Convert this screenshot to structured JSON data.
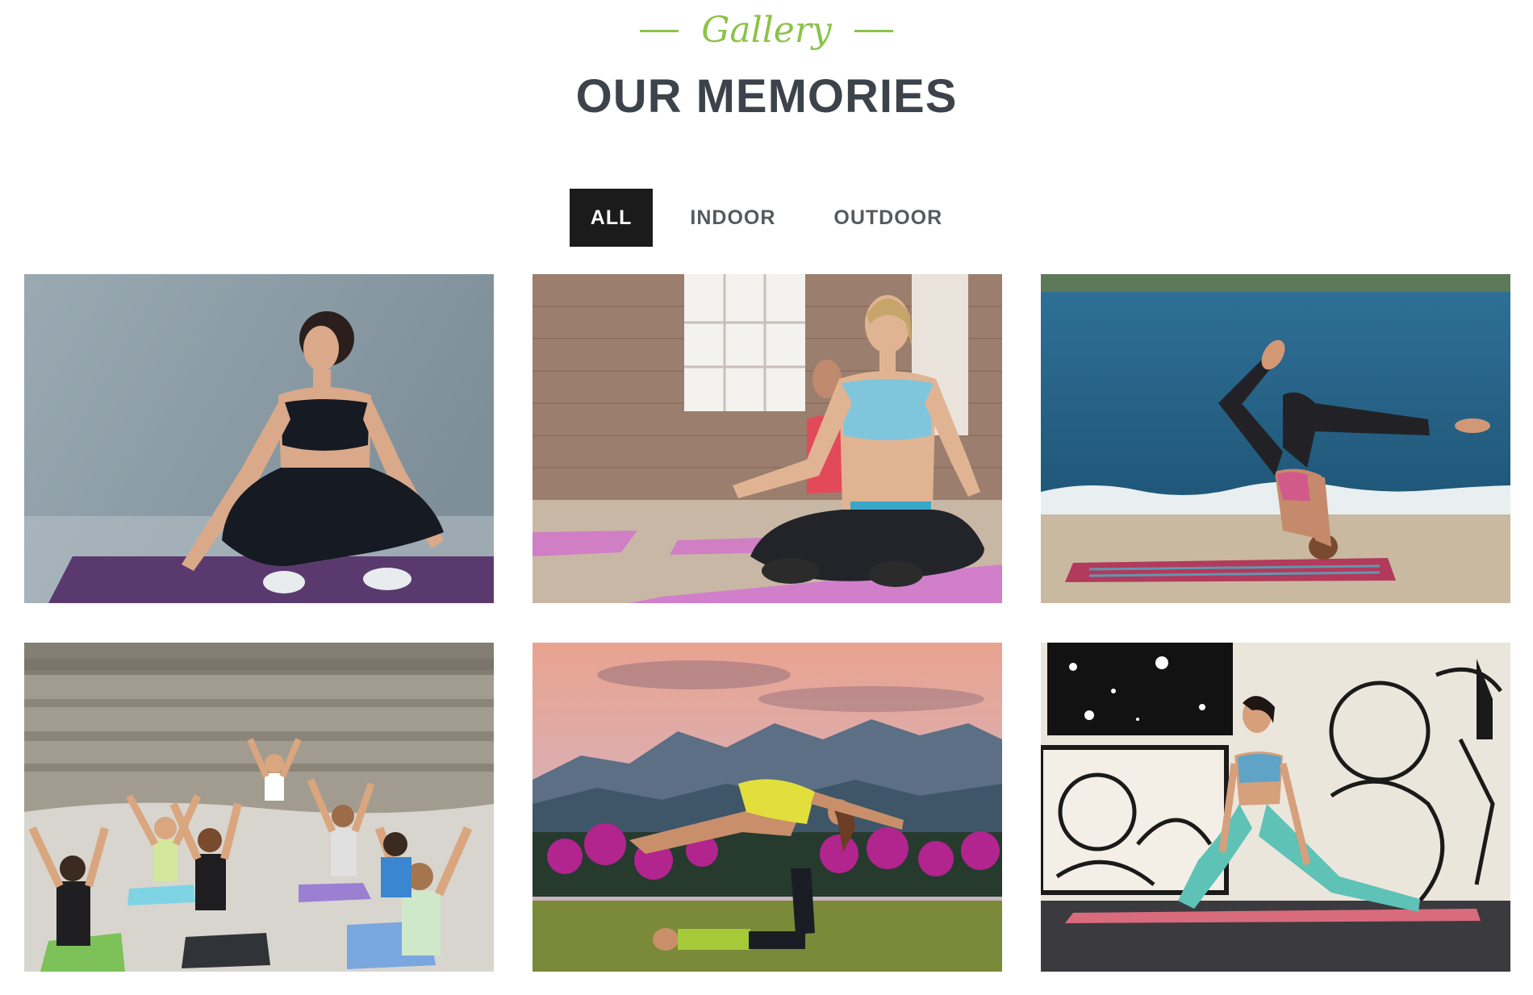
{
  "header": {
    "subtitle": "Gallery",
    "title": "OUR MEMORIES"
  },
  "filters": [
    {
      "label": "ALL",
      "active": true
    },
    {
      "label": "INDOOR",
      "active": false
    },
    {
      "label": "OUTDOOR",
      "active": false
    }
  ],
  "colors": {
    "accent": "#8bc34a",
    "title": "#3d434b",
    "active_tab_bg": "#1b1b1b",
    "tab_text": "#555a60"
  },
  "gallery": {
    "items": [
      {
        "scene": "studio-seated-pose-purple-mat"
      },
      {
        "scene": "indoor-meditation-brick-hall-pink-mats"
      },
      {
        "scene": "beach-headstand-split"
      },
      {
        "scene": "group-class-on-rocks"
      },
      {
        "scene": "acro-yoga-at-sunset-mountains"
      },
      {
        "scene": "lunge-pose-mural-wall"
      }
    ]
  }
}
